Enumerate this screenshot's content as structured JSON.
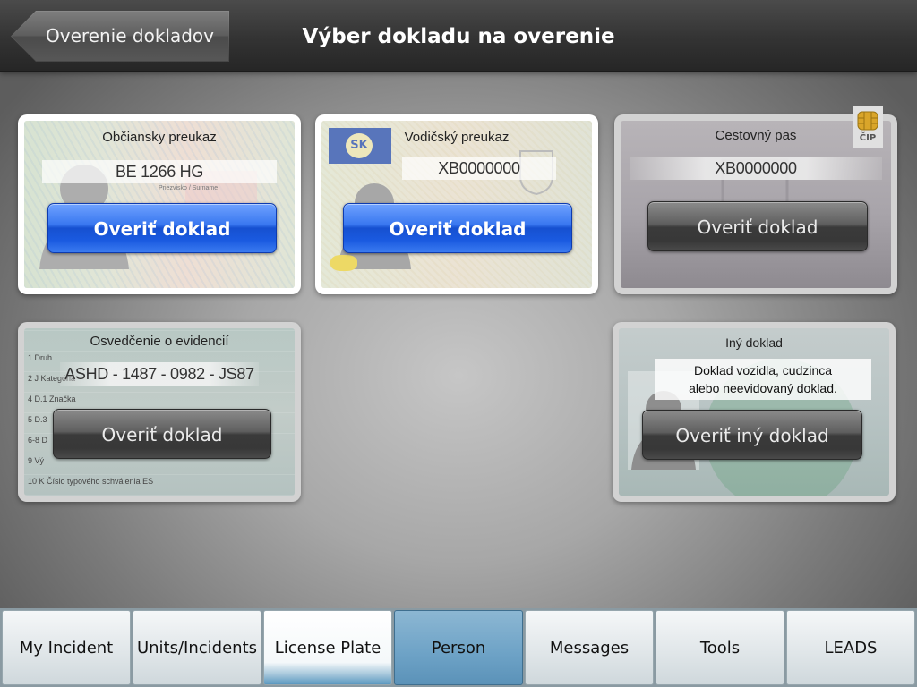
{
  "header": {
    "back_label": "Overenie dokladov",
    "title": "Výber dokladu na overenie"
  },
  "cards": {
    "id_card": {
      "title": "Občiansky preukaz",
      "number": "BE 1266 HG",
      "button": "Overiť doklad"
    },
    "driver_license": {
      "title": "Vodičský preukaz",
      "number": "XB0000000",
      "country": "SK",
      "button": "Overiť doklad"
    },
    "passport": {
      "title": "Cestovný pas",
      "number": "XB0000000",
      "chip_label": "ČIP",
      "button": "Overiť doklad"
    },
    "registration": {
      "title": "Osvedčenie o evidencií",
      "number": "ASHD - 1487 - 0982 - JS87",
      "button": "Overiť doklad"
    },
    "other": {
      "title": "Iný doklad",
      "desc_line1": "Doklad vozidla, cudzinca",
      "desc_line2": "alebo neevidovaný doklad.",
      "button": "Overiť iný doklad"
    }
  },
  "tabs": [
    {
      "label": "My Incident",
      "state": "normal"
    },
    {
      "label": "Units/Incidents",
      "state": "normal"
    },
    {
      "label": "License Plate",
      "state": "selected-light"
    },
    {
      "label": "Person",
      "state": "selected-dark"
    },
    {
      "label": "Messages",
      "state": "normal"
    },
    {
      "label": "Tools",
      "state": "normal"
    },
    {
      "label": "LEADS",
      "state": "normal"
    }
  ],
  "colors": {
    "blue_button": "#1a5ae0",
    "dark_button": "#3a3a3a",
    "tab_selected": "#6da2c6"
  }
}
